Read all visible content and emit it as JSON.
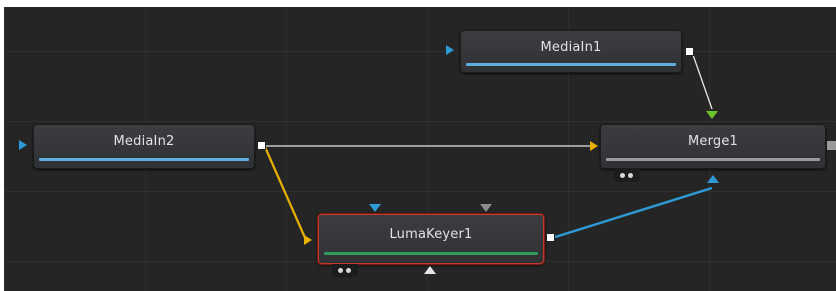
{
  "node_editor": {
    "nodes": {
      "mediain1": {
        "label": "MediaIn1"
      },
      "mediain2": {
        "label": "MediaIn2"
      },
      "merge1": {
        "label": "Merge1"
      },
      "lumakeyer1": {
        "label": "LumaKeyer1"
      }
    },
    "connections": [
      {
        "from": "MediaIn1",
        "to": "Merge1",
        "input": "foreground"
      },
      {
        "from": "MediaIn2",
        "to": "Merge1",
        "input": "background"
      },
      {
        "from": "MediaIn2",
        "to": "LumaKeyer1",
        "input": "image"
      },
      {
        "from": "LumaKeyer1",
        "to": "Merge1",
        "input": "effect-mask"
      }
    ],
    "selected_node": "LumaKeyer1",
    "colors": {
      "background": "#252525",
      "mediain_bar": "#5aaee0",
      "merge_bar": "#9a9a9a",
      "keyer_bar": "#2f9a5a",
      "background_input": "#e8b000",
      "foreground_input": "#6cc22a",
      "mask_input": "#2e9bd6",
      "selection": "#c0392b",
      "link_white": "#e6e6e6"
    }
  }
}
